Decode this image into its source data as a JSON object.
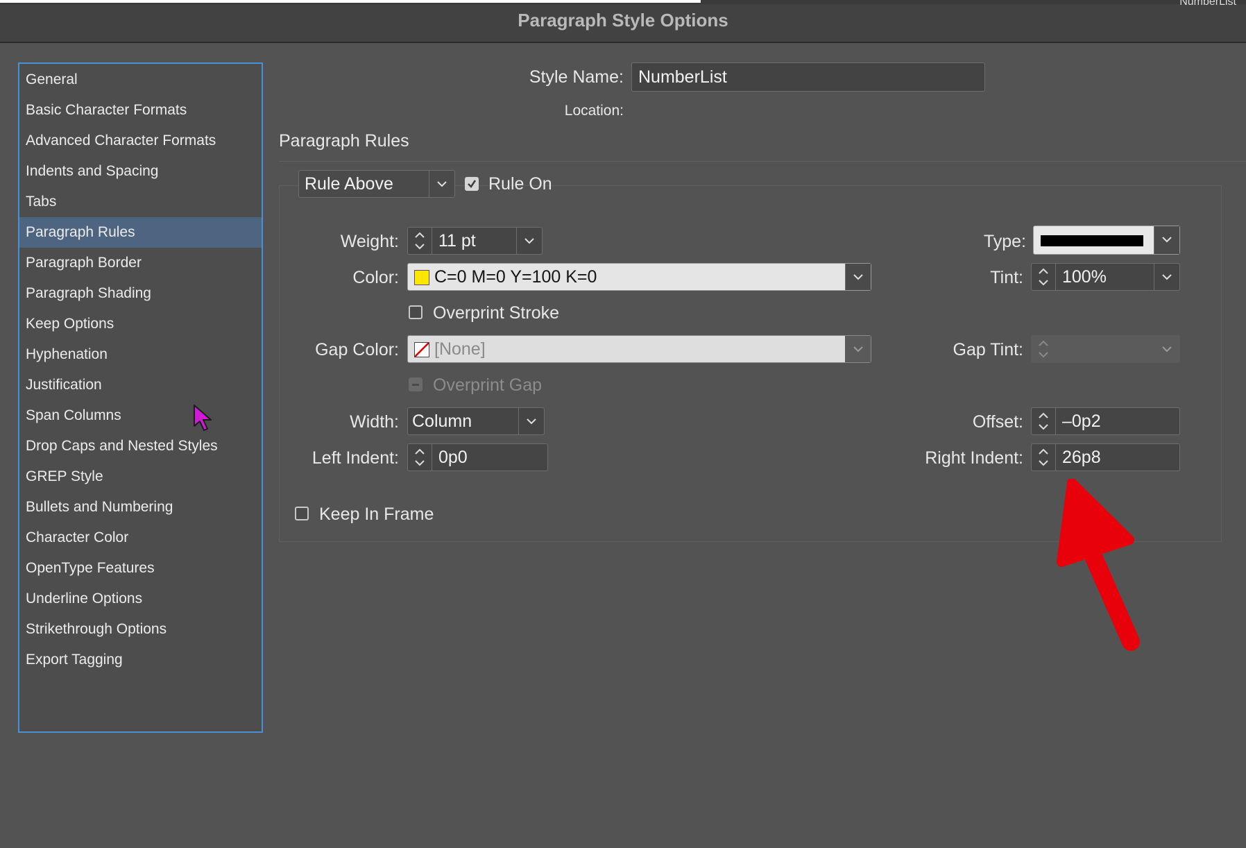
{
  "window": {
    "title": "Paragraph Style Options",
    "peek_text": "NumberList"
  },
  "sidebar": {
    "items": [
      {
        "label": "General"
      },
      {
        "label": "Basic Character Formats"
      },
      {
        "label": "Advanced Character Formats"
      },
      {
        "label": "Indents and Spacing"
      },
      {
        "label": "Tabs"
      },
      {
        "label": "Paragraph Rules",
        "selected": true
      },
      {
        "label": "Paragraph Border"
      },
      {
        "label": "Paragraph Shading"
      },
      {
        "label": "Keep Options"
      },
      {
        "label": "Hyphenation"
      },
      {
        "label": "Justification"
      },
      {
        "label": "Span Columns"
      },
      {
        "label": "Drop Caps and Nested Styles"
      },
      {
        "label": "GREP Style"
      },
      {
        "label": "Bullets and Numbering"
      },
      {
        "label": "Character Color"
      },
      {
        "label": "OpenType Features"
      },
      {
        "label": "Underline Options"
      },
      {
        "label": "Strikethrough Options"
      },
      {
        "label": "Export Tagging"
      }
    ]
  },
  "header": {
    "style_name_label": "Style Name:",
    "style_name_value": "NumberList",
    "location_label": "Location:",
    "section_title": "Paragraph Rules"
  },
  "rules": {
    "rule_select": "Rule Above",
    "rule_on_label": "Rule On",
    "rule_on_checked": true,
    "weight_label": "Weight:",
    "weight_value": "11 pt",
    "type_label": "Type:",
    "color_label": "Color:",
    "color_value": "C=0 M=0 Y=100 K=0",
    "color_swatch": "#ffe600",
    "tint_label": "Tint:",
    "tint_value": "100%",
    "overprint_stroke_label": "Overprint Stroke",
    "overprint_stroke_checked": false,
    "gap_color_label": "Gap Color:",
    "gap_color_value": "[None]",
    "gap_tint_label": "Gap Tint:",
    "gap_tint_value": "",
    "overprint_gap_label": "Overprint Gap",
    "width_label": "Width:",
    "width_value": "Column",
    "offset_label": "Offset:",
    "offset_value": "–0p2",
    "left_indent_label": "Left Indent:",
    "left_indent_value": "0p0",
    "right_indent_label": "Right Indent:",
    "right_indent_value": "26p8",
    "keep_in_frame_label": "Keep In Frame",
    "keep_in_frame_checked": false
  },
  "annotation": {
    "arrow_color": "#e8000b",
    "cursor_color": "#d21ad6"
  }
}
